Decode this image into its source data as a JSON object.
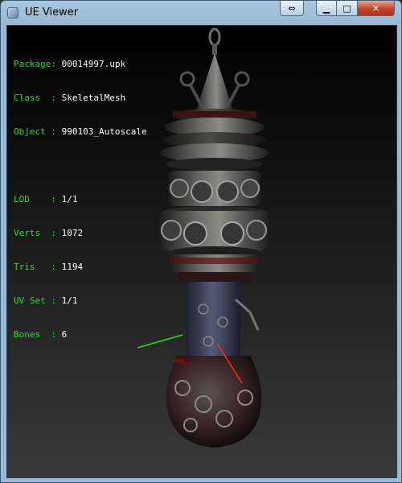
{
  "window": {
    "title": "UE Viewer",
    "buttons": {
      "extra": "⇔",
      "minimize": "▁",
      "maximize": "□",
      "close": "✕"
    }
  },
  "info": {
    "package": {
      "label": "Package:",
      "value": "00014997.upk"
    },
    "class": {
      "label": "Class  :",
      "value": "SkeletalMesh"
    },
    "object": {
      "label": "Object :",
      "value": "990103_Autoscale"
    },
    "lod": {
      "label": "LOD    :",
      "value": "1/1"
    },
    "verts": {
      "label": "Verts  :",
      "value": "1072"
    },
    "tris": {
      "label": "Tris   :",
      "value": "1194"
    },
    "uvset": {
      "label": "UV Set :",
      "value": "1/1"
    },
    "bones": {
      "label": "Bones  :",
      "value": "6"
    }
  },
  "colors": {
    "label_green": "#36d43a",
    "value_white": "#ffffff",
    "bone_green": "#22dd22",
    "bone_red": "#ff2a2a"
  }
}
